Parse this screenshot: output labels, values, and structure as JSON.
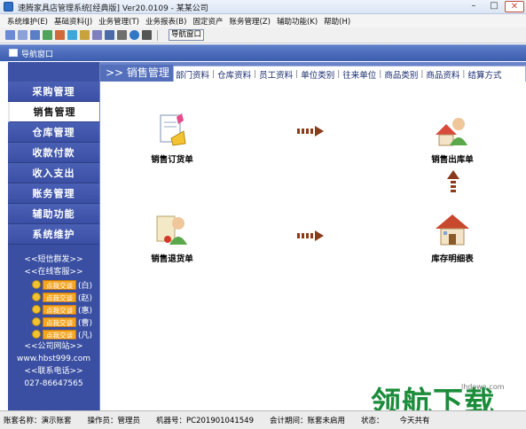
{
  "window": {
    "title": "速腾家具店管理系统[经典版] Ver20.0109  -  某某公司"
  },
  "menu": [
    "系统维护(E)",
    "基础资料(J)",
    "业务管理(T)",
    "业务报表(B)",
    "固定资产",
    "账务管理(Z)",
    "辅助功能(K)",
    "帮助(H)"
  ],
  "toolbar": {
    "nav_label": "导航窗口"
  },
  "subbar": {
    "label": "导航窗口"
  },
  "sidebar": {
    "items": [
      "采购管理",
      "销售管理",
      "仓库管理",
      "收款付款",
      "收入支出",
      "账务管理",
      "辅助功能",
      "系统维护"
    ],
    "active_index": 1,
    "sms": "<<短信群发>>",
    "online": "<<在线客服>>",
    "qq": [
      {
        "btn": "点我交谈",
        "name": "(白)"
      },
      {
        "btn": "点我交谈",
        "name": "(赵)"
      },
      {
        "btn": "点我交谈",
        "name": "(惠)"
      },
      {
        "btn": "点我交谈",
        "name": "(曹)"
      },
      {
        "btn": "点我交谈",
        "name": "(凡)"
      }
    ],
    "website_label": "<<公司网站>>",
    "website": "www.hbst999.com",
    "phone_label": "<<联系电话>>",
    "phone": "027-86647565"
  },
  "main": {
    "active_tab": ">> 销售管理",
    "tabs": [
      "部门资料",
      "仓库资料",
      "员工资料",
      "单位类别",
      "往来单位",
      "商品类别",
      "商品资料",
      "结算方式"
    ],
    "modules": {
      "sales_order": "销售订货单",
      "sales_outbound": "销售出库单",
      "sales_return": "销售退货单",
      "stock_detail": "库存明细表"
    }
  },
  "status": {
    "account": "账套名称：演示账套",
    "operator": "操作员：管理员",
    "machine": "机器号：PC201901041549",
    "period": "会计期间：账套未启用",
    "state": "状态：",
    "today": "今天共有"
  },
  "watermark": {
    "big": "领航下载",
    "small": "lhdown.com"
  },
  "colors": {
    "sidebar": "#3a4fa2",
    "accent": "#4e69b8",
    "arrow": "#8b3a1c"
  }
}
